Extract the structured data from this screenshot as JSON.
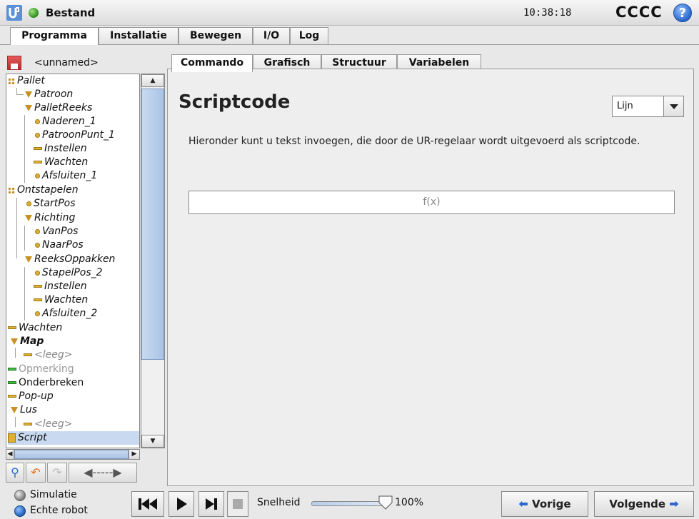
{
  "app": {
    "title": "Bestand",
    "time": "10:38:18",
    "robot_name": "CCCC",
    "help_icon": "question-icon",
    "logo_icon": "ur-logo-icon"
  },
  "main_tabs": [
    {
      "label": "Programma",
      "active": true
    },
    {
      "label": "Installatie",
      "active": false
    },
    {
      "label": "Bewegen",
      "active": false
    },
    {
      "label": "I/O",
      "active": false
    },
    {
      "label": "Log",
      "active": false
    }
  ],
  "program": {
    "filename": "<unnamed>"
  },
  "tree": [
    {
      "label": "Pallet",
      "icon": "pallet-icon"
    },
    {
      "label": "Patroon",
      "icon": "triangle-icon"
    },
    {
      "label": "PalletReeks",
      "icon": "triangle-icon"
    },
    {
      "label": "Naderen_1",
      "icon": "waypoint-icon"
    },
    {
      "label": "PatroonPunt_1",
      "icon": "waypoint-icon"
    },
    {
      "label": "Instellen",
      "icon": "action-icon"
    },
    {
      "label": "Wachten",
      "icon": "action-icon"
    },
    {
      "label": "Afsluiten_1",
      "icon": "waypoint-icon"
    },
    {
      "label": "Ontstapelen",
      "icon": "pallet-icon"
    },
    {
      "label": "StartPos",
      "icon": "waypoint-icon"
    },
    {
      "label": "Richting",
      "icon": "triangle-icon"
    },
    {
      "label": "VanPos",
      "icon": "waypoint-icon"
    },
    {
      "label": "NaarPos",
      "icon": "waypoint-icon"
    },
    {
      "label": "ReeksOppakken",
      "icon": "triangle-icon"
    },
    {
      "label": "StapelPos_2",
      "icon": "waypoint-icon"
    },
    {
      "label": "Instellen",
      "icon": "action-icon"
    },
    {
      "label": "Wachten",
      "icon": "action-icon"
    },
    {
      "label": "Afsluiten_2",
      "icon": "waypoint-icon"
    },
    {
      "label": "Wachten",
      "icon": "action-icon"
    },
    {
      "label": "Map",
      "icon": "triangle-icon"
    },
    {
      "label": "<leeg>",
      "icon": "action-icon"
    },
    {
      "label": "Opmerking",
      "icon": "comment-icon"
    },
    {
      "label": "Onderbreken",
      "icon": "halt-icon"
    },
    {
      "label": "Pop-up",
      "icon": "action-icon"
    },
    {
      "label": "Lus",
      "icon": "triangle-icon"
    },
    {
      "label": "<leeg>",
      "icon": "action-icon"
    },
    {
      "label": "Script",
      "icon": "script-icon"
    }
  ],
  "content_tabs": [
    {
      "label": "Commando",
      "active": true
    },
    {
      "label": "Grafisch",
      "active": false
    },
    {
      "label": "Structuur",
      "active": false
    },
    {
      "label": "Variabelen",
      "active": false
    }
  ],
  "script": {
    "heading": "Scriptcode",
    "mode": "Lijn",
    "description": "Hieronder kunt u tekst invoegen, die door de UR-regelaar wordt uitgevoerd als scriptcode.",
    "code_placeholder": "f(x)"
  },
  "footer": {
    "simulation_label": "Simulatie",
    "real_robot_label": "Echte robot",
    "speed_label": "Snelheid",
    "speed_value": "100%",
    "speed_fraction": 1.0,
    "prev_label": "Vorige",
    "next_label": "Volgende"
  },
  "colors": {
    "accent": "#2a66cc",
    "status_green": "#2e8b1e",
    "node_icon": "#e0b030"
  }
}
